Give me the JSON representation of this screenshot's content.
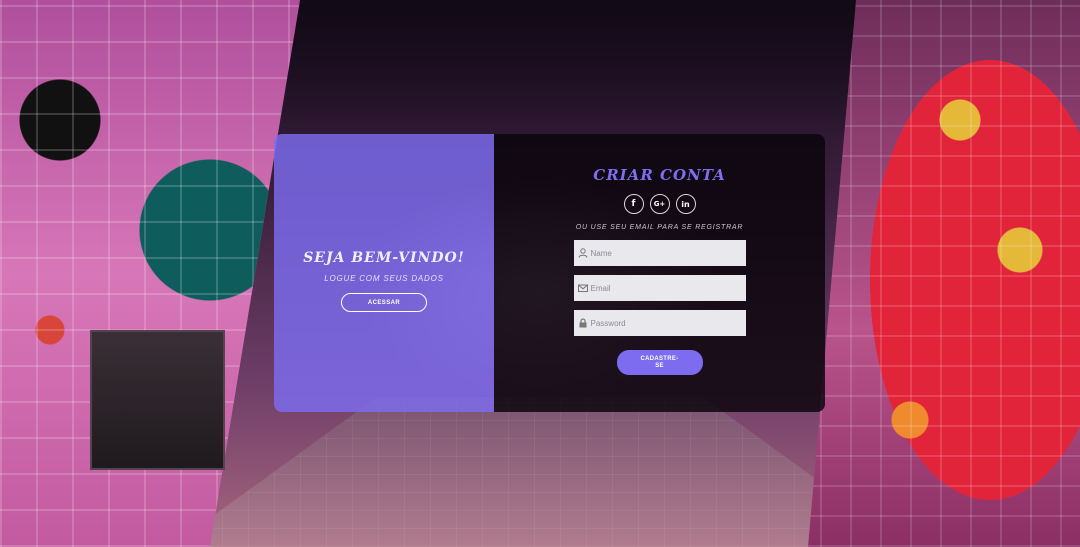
{
  "welcome": {
    "title": "SEJA BEM-VINDO!",
    "subtitle": "LOGUE COM SEUS DADOS",
    "button_label": "ACESSAR"
  },
  "register": {
    "title": "CRIAR CONTA",
    "social": [
      {
        "icon": "facebook-icon",
        "glyph": "f"
      },
      {
        "icon": "google-plus-icon",
        "glyph": "G+"
      },
      {
        "icon": "linkedin-icon",
        "glyph": "in"
      }
    ],
    "subtitle": "OU USE SEU EMAIL PARA SE REGISTRAR",
    "fields": {
      "name": {
        "placeholder": "Name",
        "icon": "user-icon"
      },
      "email": {
        "placeholder": "Email",
        "icon": "envelope-icon"
      },
      "password": {
        "placeholder": "Password",
        "icon": "lock-icon"
      }
    },
    "button_label": "CADASTRE-SE"
  },
  "colors": {
    "accent": "#7d6cf0",
    "welcome_panel": "#7c6cf0",
    "register_panel": "#08040a"
  }
}
